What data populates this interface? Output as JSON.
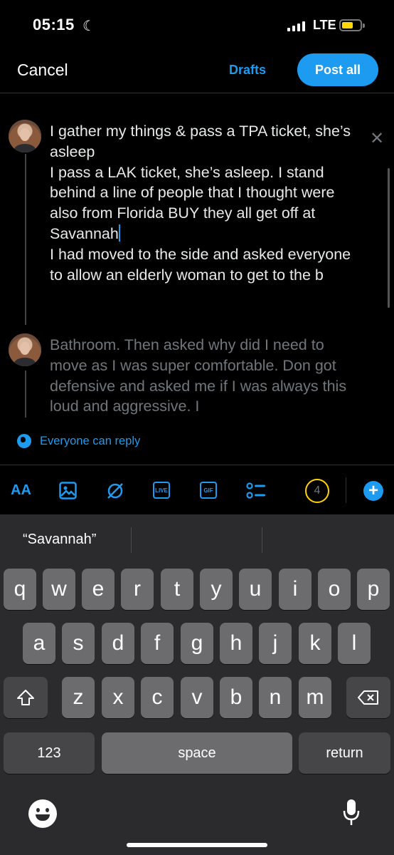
{
  "status_bar": {
    "time": "05:15",
    "network": "LTE"
  },
  "header": {
    "cancel_label": "Cancel",
    "drafts_label": "Drafts",
    "post_label": "Post all"
  },
  "thread": {
    "tweet1_text": "I gather my things & pass a TPA ticket, she’s asleep\nI pass a LAK ticket, she’s asleep. I stand behind a line of people that I thought were also from Florida BUY they all get off at Savannah",
    "tweet1_text_after_cursor": "\nI had moved to the side and asked everyone to allow an elderly woman to get to the b",
    "tweet2_text": "Bathroom. Then asked why did I need to move as I was super comfortable. Don got defensive and asked me if I was always this loud and aggressive. I"
  },
  "reply_setting": {
    "label": "Everyone can reply"
  },
  "toolbar": {
    "text_format_label": "AA",
    "live_label": "LIVE",
    "gif_label": "GIF",
    "thread_count": "4",
    "add_label": "+"
  },
  "keyboard": {
    "suggestion": "“Savannah”",
    "row1": [
      "q",
      "w",
      "e",
      "r",
      "t",
      "y",
      "u",
      "i",
      "o",
      "p"
    ],
    "row2": [
      "a",
      "s",
      "d",
      "f",
      "g",
      "h",
      "j",
      "k",
      "l"
    ],
    "row3": [
      "z",
      "x",
      "c",
      "v",
      "b",
      "n",
      "m"
    ],
    "numbers_label": "123",
    "space_label": "space",
    "return_label": "return"
  },
  "colors": {
    "accent": "#1d9bf0",
    "counter_ring": "#ffd400",
    "battery": "#ffd60a"
  }
}
